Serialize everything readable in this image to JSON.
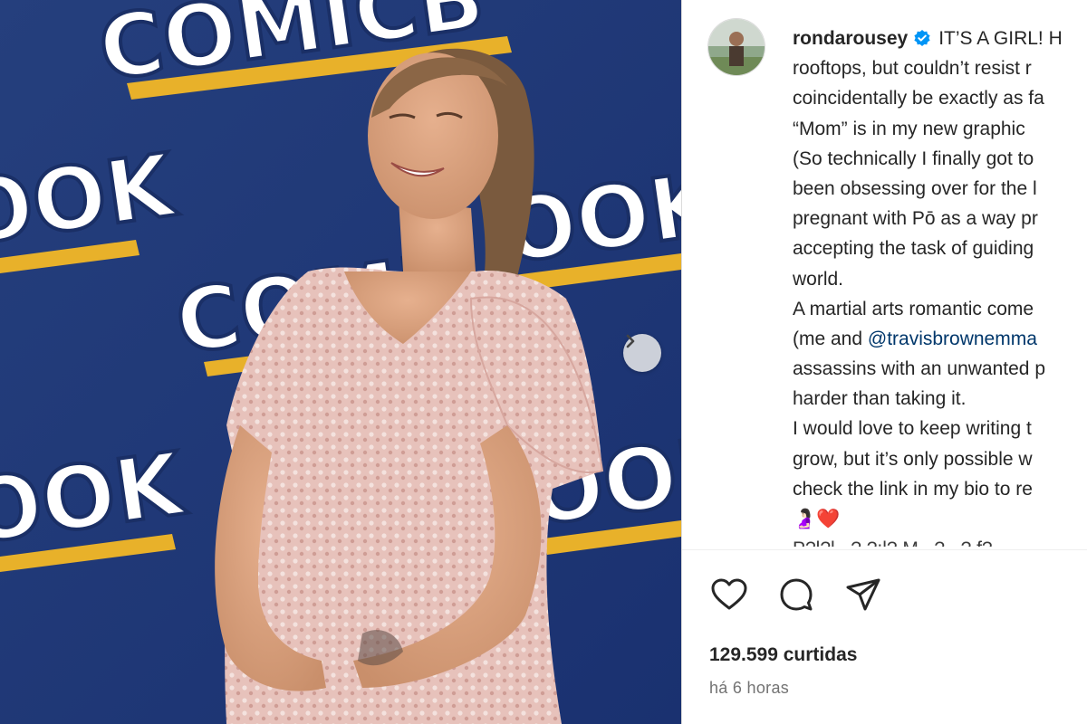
{
  "post": {
    "username": "rondarousey",
    "verified": true,
    "caption_lines": [
      "IT’S A GIRL! H",
      "rooftops, but couldn’t resist r",
      "coincidentally be exactly as fa",
      "“Mom” is in my new graphic",
      "(So technically I finally got to",
      "been obsessing over for the l",
      "pregnant with Pō as a way pr",
      "accepting the task of guiding",
      "world.",
      "A martial arts romantic come",
      "(me and ",
      "assassins with an unwanted p",
      "harder than taking it.",
      "I would love to keep writing t",
      "grow, but it’s only possible w",
      "check the link in my bio to re"
    ],
    "mention": "@travisbrownemma",
    "emoji": "🤰🏻❤️",
    "cut_line": "P?l?l...? ?:l? M ..? ..? f?..."
  },
  "backdrop": {
    "brand_text_1": "COMICB",
    "brand_text_2": "OOK",
    "brand_text_3": "COMI"
  },
  "actions": {
    "like_icon": "heart-icon",
    "comment_icon": "comment-icon",
    "share_icon": "share-icon"
  },
  "stats": {
    "likes": "129.599 curtidas",
    "time": "há 6 horas"
  },
  "colors": {
    "backdrop_blue": "#1f3a78",
    "mention": "#00376b",
    "muted": "#737373",
    "logo_yellow": "#e8b12a"
  }
}
